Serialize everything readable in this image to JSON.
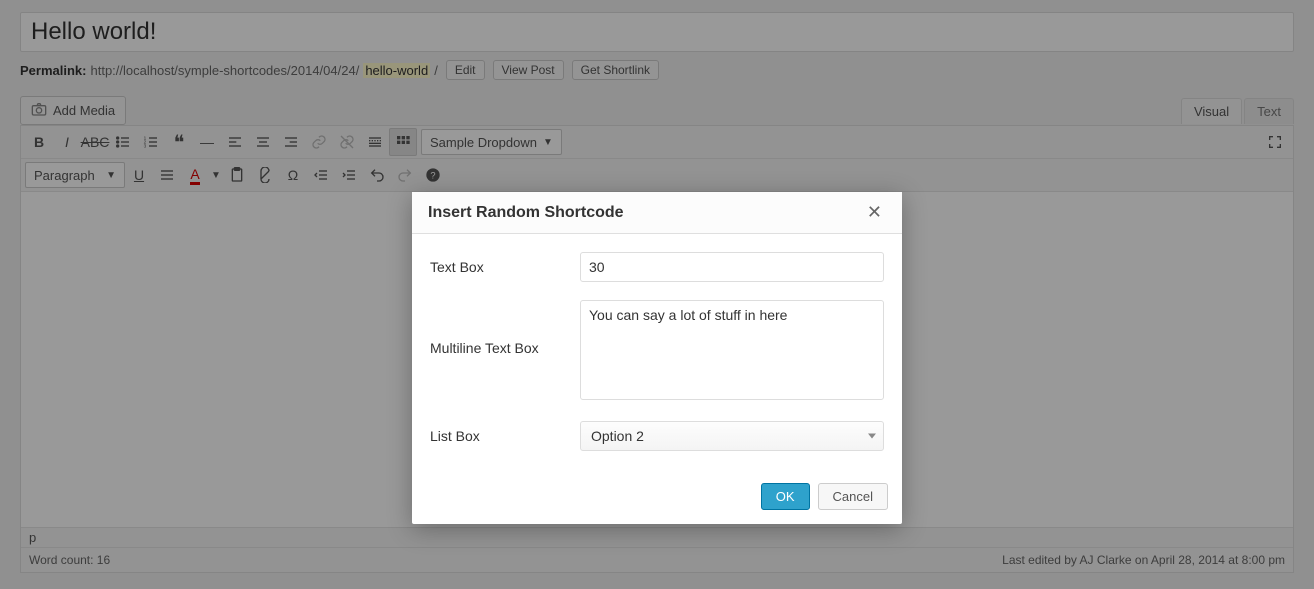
{
  "post": {
    "title": "Hello world!",
    "permalink_label": "Permalink:",
    "permalink_base": "http://localhost/symple-shortcodes/2014/04/24/",
    "permalink_slug": "hello-world",
    "permalink_trail": "/",
    "edit_btn": "Edit",
    "view_btn": "View Post",
    "shortlink_btn": "Get Shortlink"
  },
  "media": {
    "add_media": "Add Media"
  },
  "tabs": {
    "visual": "Visual",
    "text": "Text"
  },
  "toolbar": {
    "paragraph": "Paragraph",
    "sample_dropdown": "Sample Dropdown"
  },
  "status": {
    "path": "p",
    "word_count_label": "Word count: 16",
    "last_edited": "Last edited by AJ Clarke on April 28, 2014 at 8:00 pm"
  },
  "modal": {
    "title": "Insert Random Shortcode",
    "fields": {
      "text_box_label": "Text Box",
      "text_box_value": "30",
      "multiline_label": "Multiline Text Box",
      "multiline_value": "You can say a lot of stuff in here",
      "list_box_label": "List Box",
      "list_box_value": "Option 2"
    },
    "ok": "OK",
    "cancel": "Cancel"
  }
}
